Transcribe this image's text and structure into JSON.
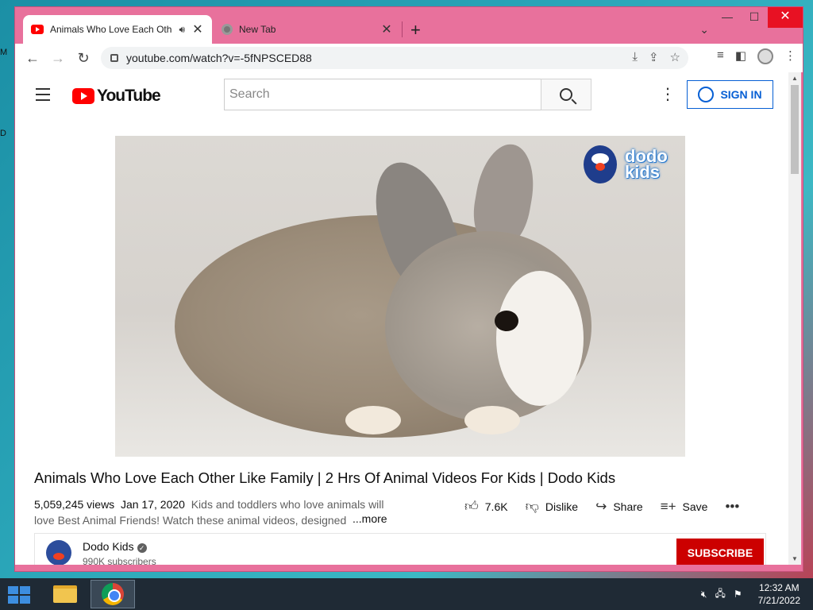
{
  "desktop": {
    "edge_letters": [
      "M",
      "D"
    ]
  },
  "browser": {
    "tabs": [
      {
        "title": "Animals Who Love Each Othe",
        "active": true,
        "audio": true
      },
      {
        "title": "New Tab",
        "active": false
      }
    ],
    "new_tab_symbol": "+",
    "close_symbol": "✕",
    "url": "youtube.com/watch?v=-5fNPSCED88",
    "window_controls": {
      "minimize": "—",
      "maximize": "☐",
      "close": "✕"
    }
  },
  "youtube": {
    "logo_text": "YouTube",
    "search_placeholder": "Search",
    "sign_in_label": "SIGN IN",
    "video": {
      "brand_line1": "dodo",
      "brand_line2": "kids",
      "title": "Animals Who Love Each Other Like Family | 2 Hrs Of Animal Videos For Kids | Dodo Kids",
      "views": "5,059,245 views",
      "date": "Jan 17, 2020",
      "description": "Kids and toddlers who love animals will love Best Animal Friends! Watch these animal videos, designed",
      "more_label": "...more",
      "likes": "7.6K",
      "dislike_label": "Dislike",
      "share_label": "Share",
      "save_label": "Save"
    },
    "channel": {
      "name": "Dodo Kids",
      "subscribers": "990K subscribers",
      "subscribe_label": "SUBSCRIBE"
    }
  },
  "taskbar": {
    "time": "12:32 AM",
    "date": "7/21/2022"
  }
}
